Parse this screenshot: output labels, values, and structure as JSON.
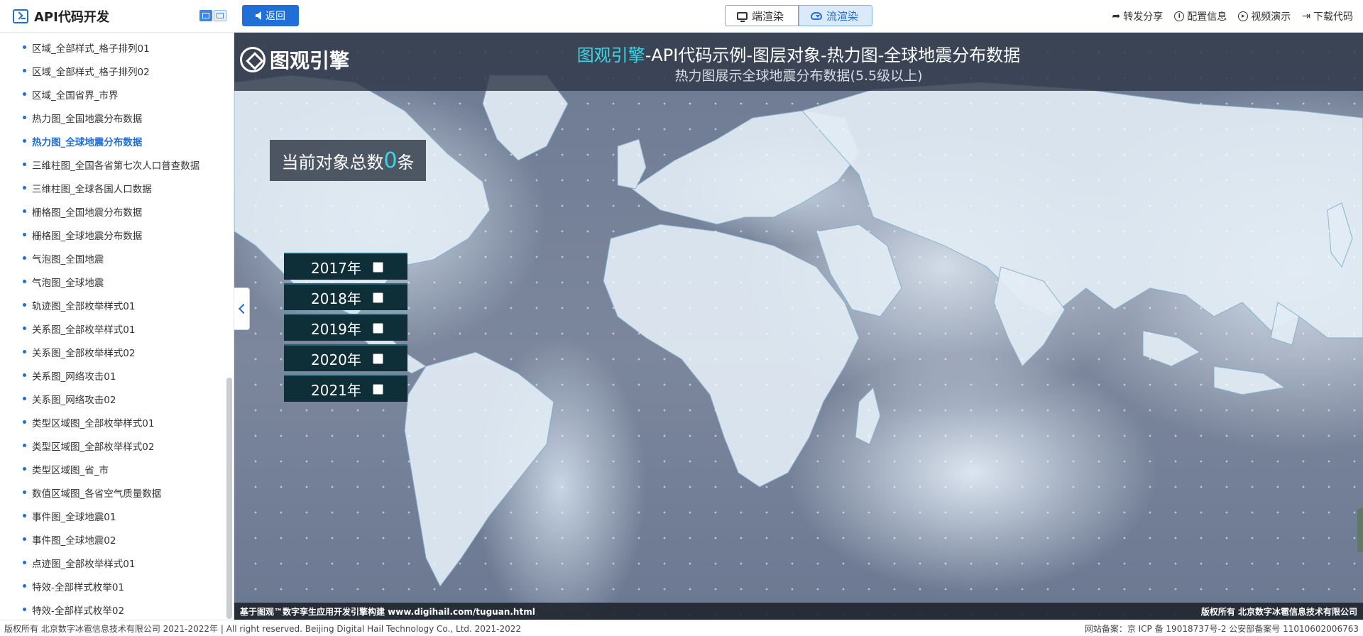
{
  "header": {
    "app_title": "API代码开发",
    "back_label": "返回",
    "render_local": "端渲染",
    "render_stream": "流渲染",
    "actions": {
      "share": "转发分享",
      "config": "配置信息",
      "video": "视频演示",
      "download": "下载代码"
    }
  },
  "sidebar": {
    "items": [
      "区域_全部样式_格子排列01",
      "区域_全部样式_格子排列02",
      "区域_全国省界_市界",
      "热力图_全国地震分布数据",
      "热力图_全球地震分布数据",
      "三维柱图_全国各省第七次人口普查数据",
      "三维柱图_全球各国人口数据",
      "栅格图_全国地震分布数据",
      "栅格图_全球地震分布数据",
      "气泡图_全国地震",
      "气泡图_全球地震",
      "轨迹图_全部枚举样式01",
      "关系图_全部枚举样式01",
      "关系图_全部枚举样式02",
      "关系图_网络攻击01",
      "关系图_网络攻击02",
      "类型区域图_全部枚举样式01",
      "类型区域图_全部枚举样式02",
      "类型区域图_省_市",
      "数值区域图_各省空气质量数据",
      "事件图_全球地震01",
      "事件图_全球地震02",
      "点迹图_全部枚举样式01",
      "特效-全部样式枚举01",
      "特效-全部样式枚举02"
    ],
    "active_index": 4
  },
  "main": {
    "logo_text": "图观引擎",
    "title_accent": "图观引擎",
    "title_rest": "-API代码示例-图层对象-热力图-全球地震分布数据",
    "subtitle": "热力图展示全球地震分布数据(5.5级以上)",
    "count_prefix": "当前对象总数",
    "count_value": "0",
    "count_suffix": "条",
    "years": [
      "2017年",
      "2018年",
      "2019年",
      "2020年",
      "2021年"
    ],
    "footer_left": "基于图观™数字孪生应用开发引擎构建 www.digihail.com/tuguan.html",
    "footer_right": "版权所有 北京数字冰雹信息技术有限公司"
  },
  "copyright": {
    "left": "版权所有 北京数字冰雹信息技术有限公司 2021-2022年 | All right reserved. Beijing Digital Hail Technology Co., Ltd. 2021-2022",
    "right": "网站备案：京 ICP 备 19018737号-2 公安部备案号 11010602006763"
  },
  "colors": {
    "primary": "#1f6fd6",
    "accent_cyan": "#39d7e6",
    "panel_dark": "#0e2e38"
  }
}
